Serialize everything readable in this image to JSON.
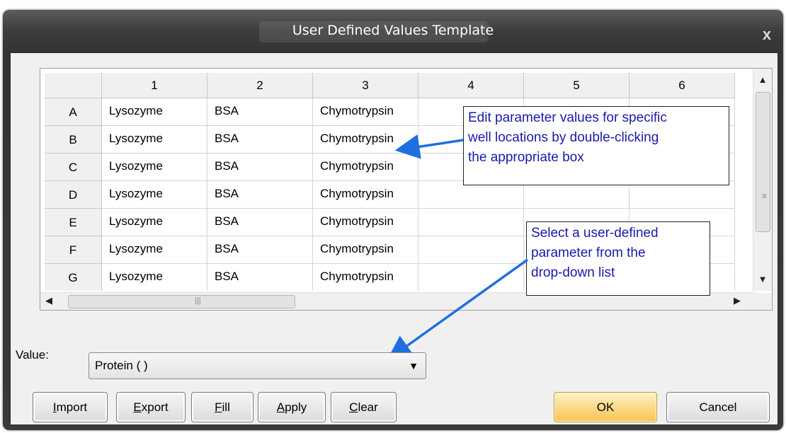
{
  "window": {
    "title": "User Defined Values Template",
    "close_label": "x"
  },
  "grid": {
    "columns": [
      "1",
      "2",
      "3",
      "4",
      "5",
      "6"
    ],
    "rows": [
      {
        "label": "A",
        "cells": [
          "Lysozyme",
          "BSA",
          "Chymotrypsin",
          "",
          "",
          ""
        ]
      },
      {
        "label": "B",
        "cells": [
          "Lysozyme",
          "BSA",
          "Chymotrypsin",
          "",
          "",
          ""
        ]
      },
      {
        "label": "C",
        "cells": [
          "Lysozyme",
          "BSA",
          "Chymotrypsin",
          "",
          "",
          ""
        ]
      },
      {
        "label": "D",
        "cells": [
          "Lysozyme",
          "BSA",
          "Chymotrypsin",
          "",
          "",
          ""
        ]
      },
      {
        "label": "E",
        "cells": [
          "Lysozyme",
          "BSA",
          "Chymotrypsin",
          "",
          "",
          ""
        ]
      },
      {
        "label": "F",
        "cells": [
          "Lysozyme",
          "BSA",
          "Chymotrypsin",
          "",
          "",
          ""
        ]
      },
      {
        "label": "G",
        "cells": [
          "Lysozyme",
          "BSA",
          "Chymotrypsin",
          "",
          "",
          ""
        ]
      }
    ]
  },
  "callouts": {
    "edit": [
      "Edit parameter values for specific",
      "well locations by double-clicking",
      "the appropriate box"
    ],
    "select": [
      "Select a user-defined",
      "parameter from the",
      "drop-down list"
    ]
  },
  "value": {
    "label": "Value:",
    "selected": "Protein ( )"
  },
  "buttons": {
    "import": {
      "first": "I",
      "rest": "mport"
    },
    "export": {
      "first": "E",
      "rest": "xport"
    },
    "fill": {
      "first": "F",
      "rest": "ill"
    },
    "apply": {
      "first": "A",
      "rest": "pply"
    },
    "clear": {
      "first": "C",
      "rest": "lear"
    },
    "ok": "OK",
    "cancel": "Cancel"
  },
  "colors": {
    "callout_text": "#1a1aa8",
    "arrow": "#1e6fe0",
    "ok_button": "#f7c451"
  },
  "icons": {
    "close": "close-icon",
    "dropdown": "chevron-down-icon",
    "scroll_up": "scroll-up-icon",
    "scroll_down": "scroll-down-icon",
    "scroll_left": "scroll-left-icon",
    "scroll_right": "scroll-right-icon"
  }
}
